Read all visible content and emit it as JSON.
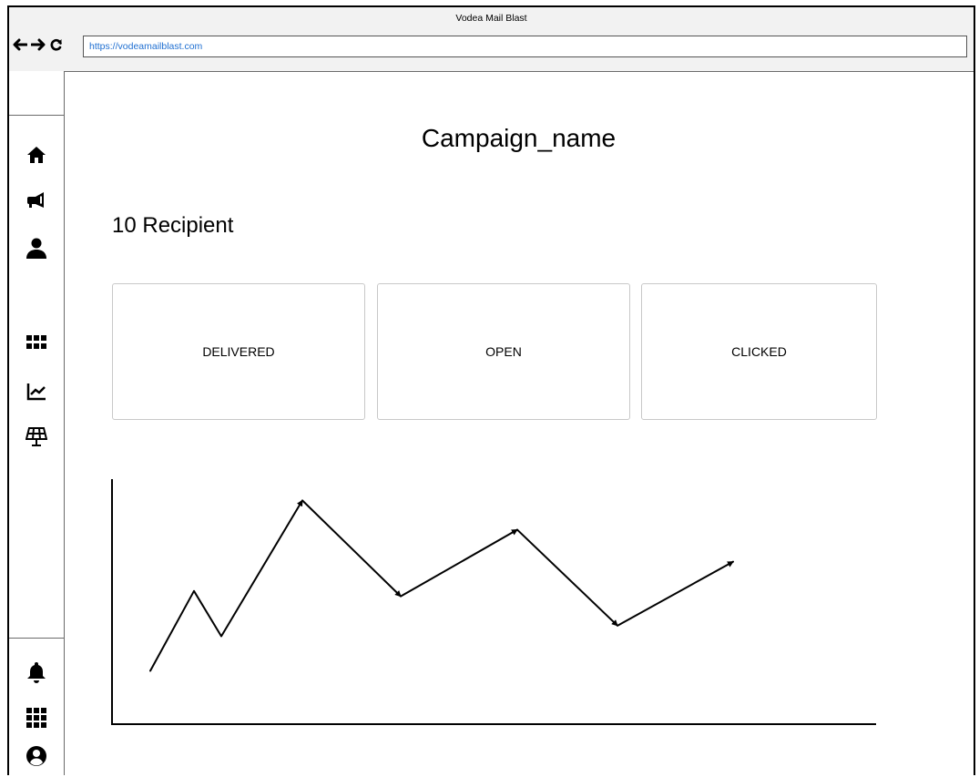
{
  "window": {
    "title": "Vodea Mail Blast"
  },
  "browser": {
    "url": "https://vodeamailblast.com"
  },
  "icons": {
    "back": "arrow-left-icon",
    "forward": "arrow-right-icon",
    "reload": "reload-icon",
    "home": "home-icon",
    "campaign": "megaphone-icon",
    "contacts": "user-icon",
    "apps": "grid-icon",
    "analytics": "line-chart-icon",
    "solar": "solar-panel-icon",
    "notifications": "bell-icon",
    "menu": "grid-icon",
    "account": "account-circle-icon"
  },
  "page": {
    "title": "Campaign_name",
    "recipient_count": "10 Recipient"
  },
  "stats": [
    {
      "label": "DELIVERED"
    },
    {
      "label": "OPEN"
    },
    {
      "label": "CLICKED"
    }
  ],
  "chart_data": {
    "type": "line",
    "title": "",
    "xlabel": "",
    "ylabel": "",
    "x": [
      1,
      2,
      3,
      4,
      5,
      6,
      7,
      8
    ],
    "series": [
      {
        "values": [
          2,
          5,
          3.3,
          8.4,
          4.8,
          7.3,
          3.7,
          6.1
        ]
      }
    ],
    "ylim": [
      0,
      9.2
    ],
    "grid": false
  }
}
